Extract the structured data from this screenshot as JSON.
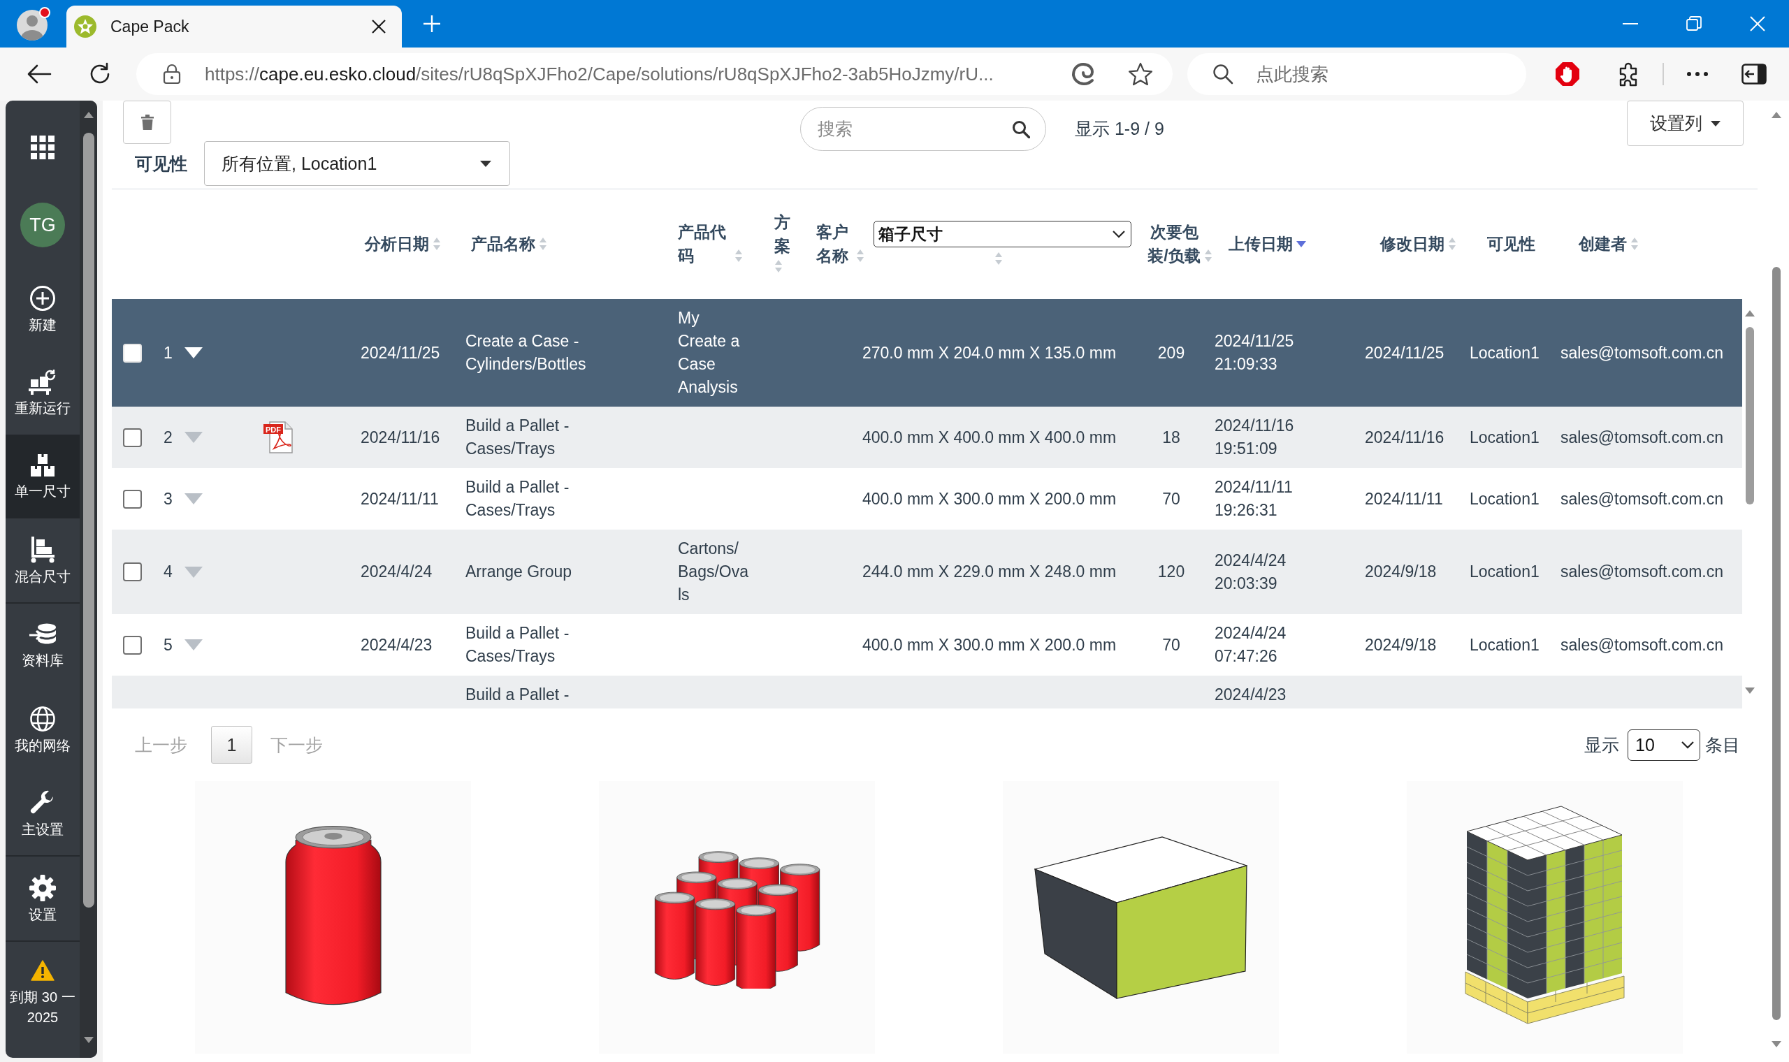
{
  "browser": {
    "tab_title": "Cape Pack",
    "url": {
      "scheme": "https://",
      "host": "cape.eu.esko.cloud",
      "path": "/sites/rU8qSpXJFho2/Cape/solutions/rU8qSpXJFho2-3ab5HoJzmy/rU..."
    },
    "search_placeholder": "点此搜索"
  },
  "sidebar": {
    "avatar": "TG",
    "items": [
      {
        "label": "新建",
        "selected": false
      },
      {
        "label": "重新运行",
        "selected": false
      },
      {
        "label": "单一尺寸",
        "selected": true
      },
      {
        "label": "混合尺寸",
        "selected": false
      },
      {
        "label": "资料库",
        "selected": false
      },
      {
        "label": "我的网络",
        "selected": false
      },
      {
        "label": "主设置",
        "selected": false
      },
      {
        "label": "设置",
        "selected": false
      }
    ],
    "notice": "到期 30 一 2025"
  },
  "toolbar": {
    "visibility_label": "可见性",
    "visibility_value": "所有位置, Location1",
    "search_placeholder": "搜索",
    "count": "显示 1-9 / 9",
    "columns_button": "设置列"
  },
  "table": {
    "columns": [
      {
        "label": "分析日期",
        "kind": "text",
        "sortable": true,
        "sorted": false
      },
      {
        "label": "产品名称",
        "kind": "text",
        "sortable": true,
        "sorted": false
      },
      {
        "label": "产品代码",
        "kind": "text",
        "sortable": true,
        "sorted": false
      },
      {
        "label": "方案",
        "kind": "text",
        "sortable": true,
        "sorted": false
      },
      {
        "label": "客户名称",
        "kind": "text",
        "sortable": true,
        "sorted": false
      },
      {
        "label": "箱子尺寸",
        "kind": "select",
        "sortable": true,
        "sorted": false
      },
      {
        "label": "次要包装/负载",
        "kind": "text",
        "sortable": true,
        "sorted": false
      },
      {
        "label": "上传日期",
        "kind": "text",
        "sortable": true,
        "sorted": true
      },
      {
        "label": "修改日期",
        "kind": "text",
        "sortable": true,
        "sorted": false
      },
      {
        "label": "可见性",
        "kind": "text",
        "sortable": false,
        "sorted": false
      },
      {
        "label": "创建者",
        "kind": "text",
        "sortable": true,
        "sorted": false
      }
    ],
    "rows": [
      {
        "selected": true,
        "checked": false,
        "number": "1",
        "analysis_date": "2024/11/25",
        "product_name": "Create a Case - Cylinders/Bottles",
        "product_code": "My Create a Case Analysis",
        "case_size": "270.0 mm X 204.0 mm X 135.0 mm",
        "secondary_pack": "209",
        "upload_date": "2024/11/25 21:09:33",
        "modified_date": "2024/11/25",
        "visibility": "Location1",
        "creator": "sales@tomsoft.com.cn"
      },
      {
        "selected": false,
        "checked": false,
        "number": "2",
        "file_type": "PDF",
        "analysis_date": "2024/11/16",
        "product_name": "Build a Pallet - Cases/Trays",
        "case_size": "400.0 mm X 400.0 mm X 400.0 mm",
        "secondary_pack": "18",
        "upload_date": "2024/11/16 19:51:09",
        "modified_date": "2024/11/16",
        "visibility": "Location1",
        "creator": "sales@tomsoft.com.cn"
      },
      {
        "selected": false,
        "checked": false,
        "number": "3",
        "analysis_date": "2024/11/11",
        "product_name": "Build a Pallet - Cases/Trays",
        "case_size": "400.0 mm X 300.0 mm X 200.0 mm",
        "secondary_pack": "70",
        "upload_date": "2024/11/11 19:26:31",
        "modified_date": "2024/11/11",
        "visibility": "Location1",
        "creator": "sales@tomsoft.com.cn"
      },
      {
        "selected": false,
        "checked": false,
        "number": "4",
        "analysis_date": "2024/4/24",
        "product_name": "Arrange Group",
        "product_code": "Cartons/Bags/Ovals",
        "case_size": "244.0 mm X 229.0 mm X 248.0 mm",
        "secondary_pack": "120",
        "upload_date": "2024/4/24 20:03:39",
        "modified_date": "2024/9/18",
        "visibility": "Location1",
        "creator": "sales@tomsoft.com.cn"
      },
      {
        "selected": false,
        "checked": false,
        "number": "5",
        "analysis_date": "2024/4/23",
        "product_name": "Build a Pallet - Cases/Trays",
        "case_size": "400.0 mm X 300.0 mm X 200.0 mm",
        "secondary_pack": "70",
        "upload_date": "2024/4/24 07:47:26",
        "modified_date": "2024/9/18",
        "visibility": "Location1",
        "creator": "sales@tomsoft.com.cn"
      },
      {
        "selected": false,
        "product_name": "Build a Pallet -",
        "upload_date": "2024/4/23"
      }
    ]
  },
  "pagination": {
    "prev": {
      "label": "上一步",
      "disabled": true
    },
    "pages": [
      {
        "label": "1",
        "selected": true
      }
    ],
    "next": {
      "label": "下一步",
      "disabled": true
    },
    "size_label": "显示",
    "size_value": "10",
    "size_suffix": "条目"
  },
  "previews": [
    {
      "kind": "can"
    },
    {
      "kind": "can_pack"
    },
    {
      "kind": "case"
    },
    {
      "kind": "pallet"
    }
  ]
}
